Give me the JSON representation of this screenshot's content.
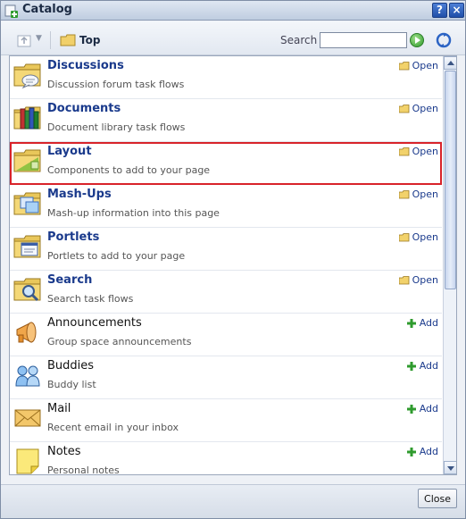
{
  "window": {
    "title": "Catalog",
    "help_label": "?",
    "close_label": "×"
  },
  "toolbar": {
    "breadcrumb": "Top",
    "search_label": "Search",
    "search_value": ""
  },
  "items": [
    {
      "name": "Discussions",
      "desc": "Discussion forum task flows",
      "action": "Open",
      "icon": "folder-discussions-icon",
      "kind": "folder"
    },
    {
      "name": "Documents",
      "desc": "Document library task flows",
      "action": "Open",
      "icon": "folder-documents-icon",
      "kind": "folder"
    },
    {
      "name": "Layout",
      "desc": "Components to add to your page",
      "action": "Open",
      "icon": "folder-layout-icon",
      "kind": "folder",
      "selected": true
    },
    {
      "name": "Mash-Ups",
      "desc": "Mash-up information into this page",
      "action": "Open",
      "icon": "folder-mashups-icon",
      "kind": "folder"
    },
    {
      "name": "Portlets",
      "desc": "Portlets to add to your page",
      "action": "Open",
      "icon": "folder-portlets-icon",
      "kind": "folder"
    },
    {
      "name": "Search",
      "desc": "Search task flows",
      "action": "Open",
      "icon": "folder-search-icon",
      "kind": "folder"
    },
    {
      "name": "Announcements",
      "desc": "Group space announcements",
      "action": "Add",
      "icon": "megaphone-icon",
      "kind": "component"
    },
    {
      "name": "Buddies",
      "desc": "Buddy list",
      "action": "Add",
      "icon": "buddies-icon",
      "kind": "component"
    },
    {
      "name": "Mail",
      "desc": "Recent email in your inbox",
      "action": "Add",
      "icon": "envelope-icon",
      "kind": "component"
    },
    {
      "name": "Notes",
      "desc": "Personal notes",
      "action": "Add",
      "icon": "note-icon",
      "kind": "component"
    }
  ],
  "footer": {
    "close_label": "Close"
  },
  "colors": {
    "selection_border": "#d8232a",
    "link_blue": "#1a3a8c"
  }
}
